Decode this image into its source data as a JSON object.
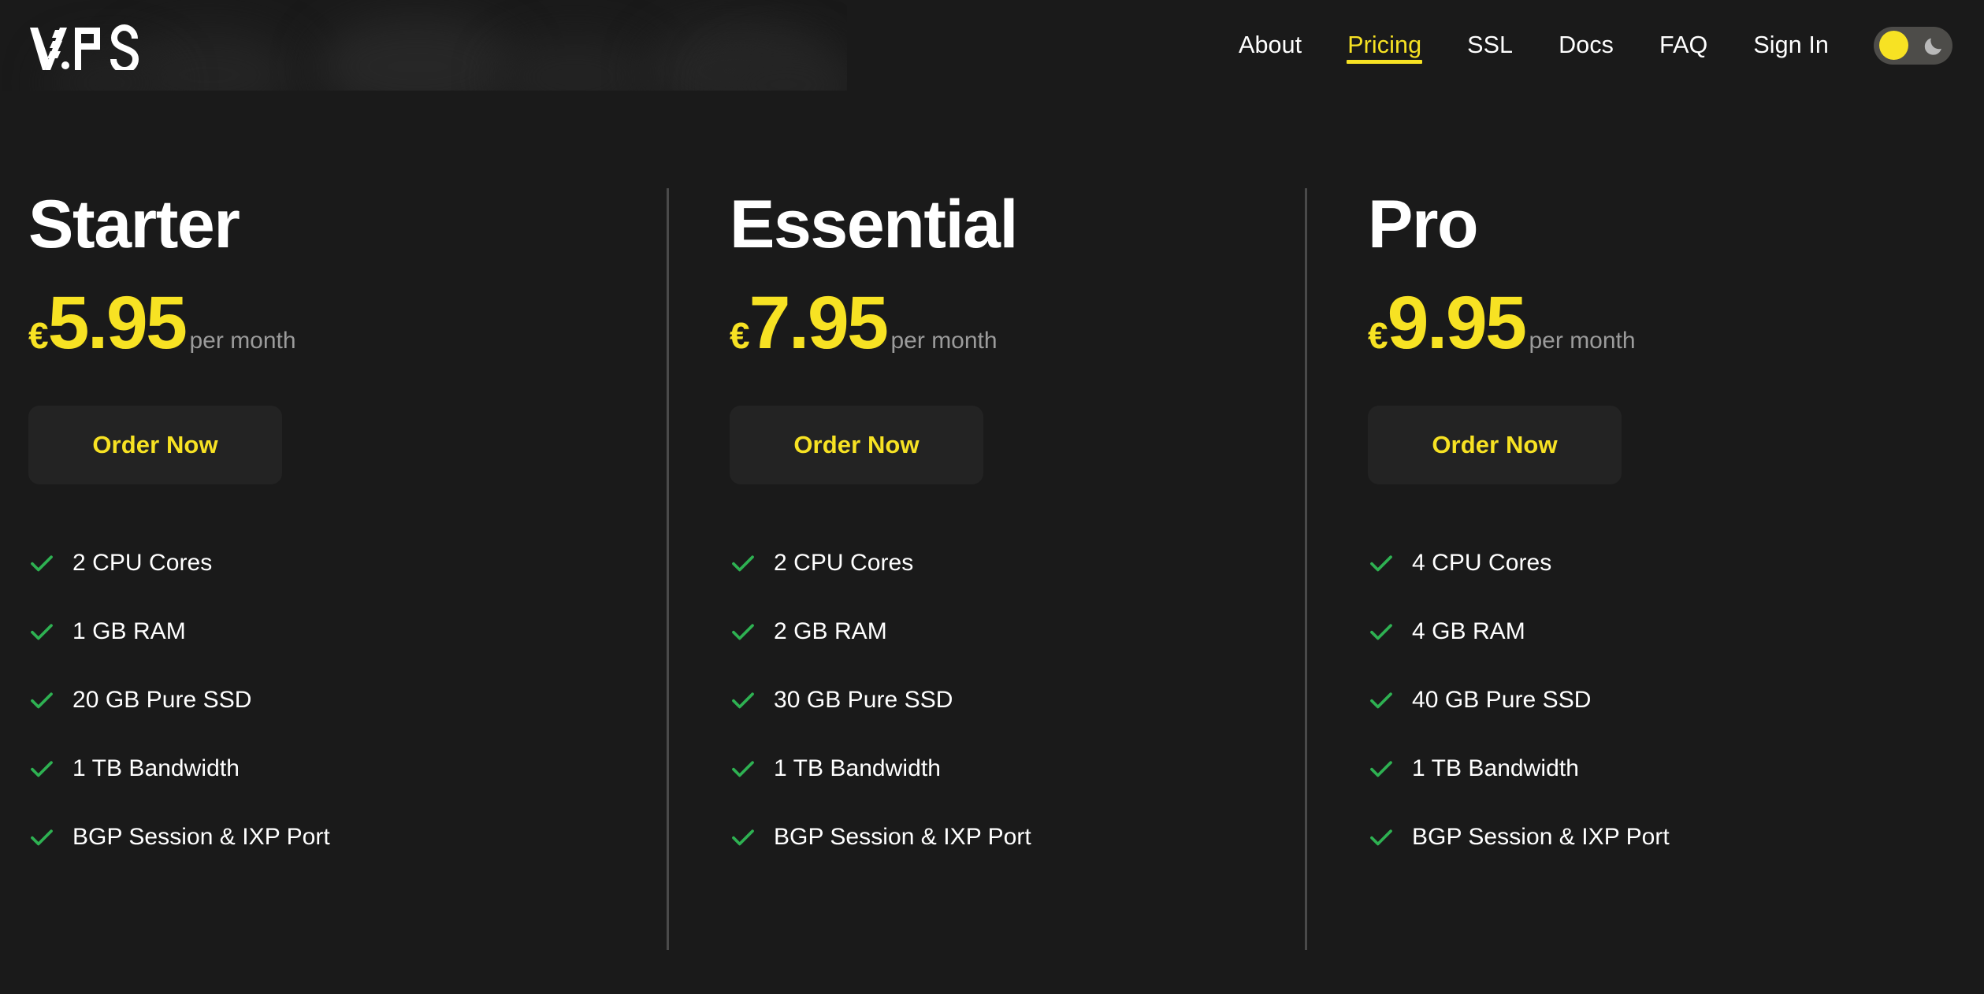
{
  "brand": {
    "logo_text": "V.PS",
    "logo_icon": "vps-logo-icon"
  },
  "nav": {
    "items": [
      {
        "label": "About",
        "active": false
      },
      {
        "label": "Pricing",
        "active": true
      },
      {
        "label": "SSL",
        "active": false
      },
      {
        "label": "Docs",
        "active": false
      },
      {
        "label": "FAQ",
        "active": false
      },
      {
        "label": "Sign In",
        "active": false
      }
    ],
    "theme_toggle": {
      "state": "light",
      "sun_icon": "sun-icon",
      "moon_icon": "moon-icon"
    }
  },
  "colors": {
    "accent": "#f7e223",
    "background": "#1a1a1a",
    "button_bg": "#232323",
    "check": "#2eb152",
    "muted_text": "#9b9b9b",
    "divider": "#4a4a4a",
    "toggle_track": "#4d4c49"
  },
  "pricing": {
    "plans": [
      {
        "name": "Starter",
        "currency": "€",
        "amount": "5.95",
        "period": "per month",
        "cta": "Order Now",
        "features": [
          "2 CPU Cores",
          "1 GB RAM",
          "20 GB Pure SSD",
          "1 TB Bandwidth",
          "BGP Session & IXP Port"
        ]
      },
      {
        "name": "Essential",
        "currency": "€",
        "amount": "7.95",
        "period": "per month",
        "cta": "Order Now",
        "features": [
          "2 CPU Cores",
          "2 GB RAM",
          "30 GB Pure SSD",
          "1 TB Bandwidth",
          "BGP Session & IXP Port"
        ]
      },
      {
        "name": "Pro",
        "currency": "€",
        "amount": "9.95",
        "period": "per month",
        "cta": "Order Now",
        "features": [
          "4 CPU Cores",
          "4 GB RAM",
          "40 GB Pure SSD",
          "1 TB Bandwidth",
          "BGP Session & IXP Port"
        ]
      }
    ]
  }
}
